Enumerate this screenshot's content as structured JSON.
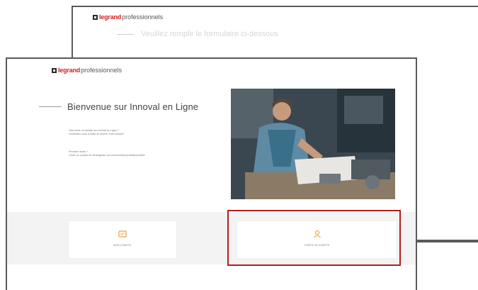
{
  "back_window": {
    "logo_brand": "legrand",
    "logo_suffix": "professionnels",
    "subtitle": "Veuillez remplir le formulaire ci-dessous"
  },
  "front_window": {
    "logo_brand": "legrand",
    "logo_suffix": "professionnels",
    "welcome_title": "Bienvenue sur Innoval en Ligne",
    "text_line_1": "Vous avez un compte sur Innoval en Ligne ?",
    "text_line_2": "Connectez-vous à l'aide du bouton \"mon compte\"",
    "text_line_3": "Première visite ?",
    "text_line_4": "Créez un compte en renseignant vos coordonnées professionnelles",
    "cards": [
      {
        "label": "MON COMPTE"
      },
      {
        "label": "CRÉER UN COMPTE"
      }
    ]
  },
  "colors": {
    "brand_red": "#d31f1f",
    "highlight_red": "#b41d1d",
    "accent_orange": "#f0a030"
  }
}
